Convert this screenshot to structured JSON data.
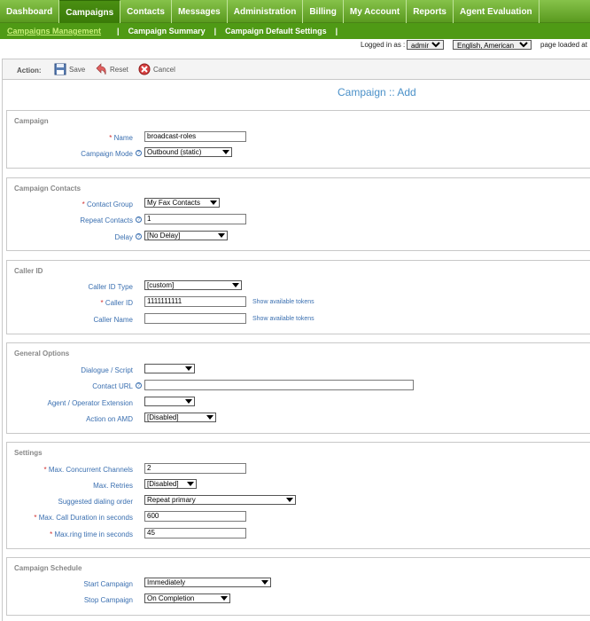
{
  "nav": {
    "tabs": [
      "Dashboard",
      "Campaigns",
      "Contacts",
      "Messages",
      "Administration",
      "Billing",
      "My Account",
      "Reports",
      "Agent Evaluation"
    ],
    "active": "Campaigns"
  },
  "subnav": {
    "items": [
      "Campaigns Management",
      "Campaign Summary",
      "Campaign Default Settings"
    ],
    "active": "Campaigns Management",
    "separator": "|"
  },
  "login": {
    "label": "Logged in as :",
    "user": "admin",
    "language": "English, American",
    "page_loaded": "page loaded at"
  },
  "action_bar": {
    "label": "Action:",
    "save": "Save",
    "reset": "Reset",
    "cancel": "Cancel"
  },
  "page_title": "Campaign :: Add",
  "sections": {
    "campaign": {
      "title": "Campaign",
      "name_label": "Name",
      "name_value": "broadcast-roles",
      "mode_label": "Campaign Mode",
      "mode_value": "Outbound (static)"
    },
    "contacts": {
      "title": "Campaign Contacts",
      "group_label": "Contact Group",
      "group_value": "My Fax Contacts",
      "repeat_label": "Repeat Contacts",
      "repeat_value": "1",
      "delay_label": "Delay",
      "delay_value": "[No Delay]"
    },
    "callerid": {
      "title": "Caller ID",
      "type_label": "Caller ID Type",
      "type_value": "[custom]",
      "id_label": "Caller ID",
      "id_value": "1111111111",
      "name_label": "Caller Name",
      "name_value": "",
      "tokens_link": "Show available tokens"
    },
    "general": {
      "title": "General Options",
      "dialogue_label": "Dialogue / Script",
      "dialogue_value": "",
      "url_label": "Contact URL",
      "url_value": "",
      "ext_label": "Agent / Operator Extension",
      "ext_value": "",
      "amd_label": "Action on AMD",
      "amd_value": "[Disabled]"
    },
    "settings": {
      "title": "Settings",
      "channels_label": "Max. Concurrent Channels",
      "channels_value": "2",
      "retries_label": "Max. Retries",
      "retries_value": "[Disabled]",
      "order_label": "Suggested dialing order",
      "order_value": "Repeat primary",
      "duration_label": "Max. Call Duration in seconds",
      "duration_value": "600",
      "ring_label": "Max.ring time in seconds",
      "ring_value": "45"
    },
    "schedule": {
      "title": "Campaign Schedule",
      "start_label": "Start Campaign",
      "start_value": "Immediately",
      "stop_label": "Stop Campaign",
      "stop_value": "On Completion"
    }
  },
  "required_marker": "*",
  "help_glyph": "?"
}
